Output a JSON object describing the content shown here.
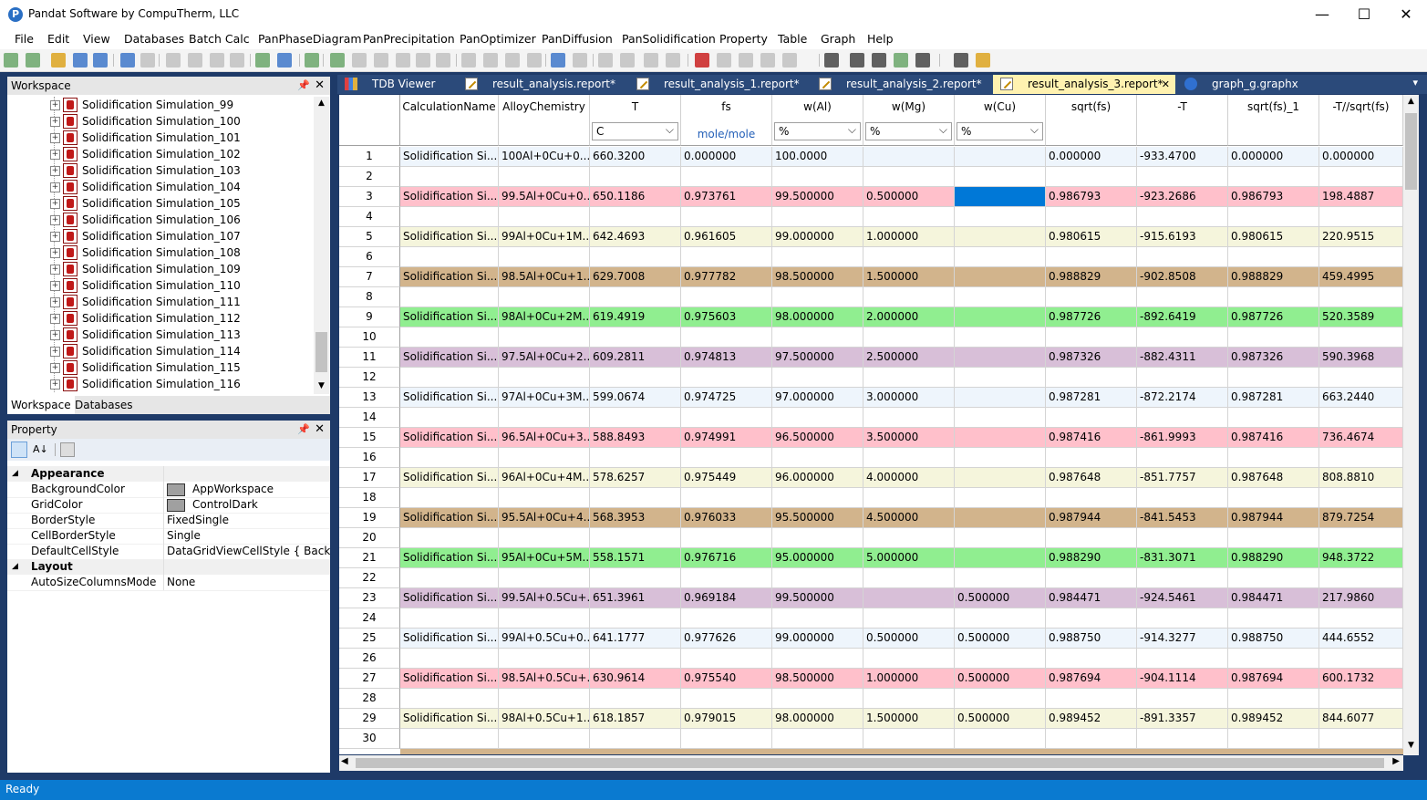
{
  "window": {
    "title": "Pandat Software by CompuTherm, LLC",
    "minimize": "—",
    "maximize": "☐",
    "close": "✕"
  },
  "menu": [
    "File",
    "Edit",
    "View",
    "Databases",
    "Batch Calc",
    "PanPhaseDiagram",
    "PanPrecipitation",
    "PanOptimizer",
    "PanDiffusion",
    "PanSolidification",
    "Property",
    "Table",
    "Graph",
    "Help"
  ],
  "workspace": {
    "title": "Workspace",
    "items": [
      "Solidification Simulation_99",
      "Solidification Simulation_100",
      "Solidification Simulation_101",
      "Solidification Simulation_102",
      "Solidification Simulation_103",
      "Solidification Simulation_104",
      "Solidification Simulation_105",
      "Solidification Simulation_106",
      "Solidification Simulation_107",
      "Solidification Simulation_108",
      "Solidification Simulation_109",
      "Solidification Simulation_110",
      "Solidification Simulation_111",
      "Solidification Simulation_112",
      "Solidification Simulation_113",
      "Solidification Simulation_114",
      "Solidification Simulation_115",
      "Solidification Simulation_116"
    ],
    "tabs": [
      "Workspace",
      "Databases"
    ]
  },
  "property": {
    "title": "Property",
    "categories": [
      {
        "name": "Appearance",
        "rows": [
          {
            "name": "BackgroundColor",
            "value": "AppWorkspace",
            "swatch": "#a0a0a0"
          },
          {
            "name": "GridColor",
            "value": "ControlDark",
            "swatch": "#a0a0a0"
          },
          {
            "name": "BorderStyle",
            "value": "FixedSingle"
          },
          {
            "name": "CellBorderStyle",
            "value": "Single"
          },
          {
            "name": "DefaultCellStyle",
            "value": "DataGridViewCellStyle { BackColor"
          }
        ]
      },
      {
        "name": "Layout",
        "rows": [
          {
            "name": "AutoSizeColumnsMode",
            "value": "None"
          }
        ]
      }
    ]
  },
  "doctabs": [
    {
      "label": "TDB Viewer",
      "icon": "tdb-icon"
    },
    {
      "label": "result_analysis.report*",
      "icon": "report-icon"
    },
    {
      "label": "result_analysis_1.report*",
      "icon": "report-icon"
    },
    {
      "label": "result_analysis_2.report*",
      "icon": "report-icon"
    },
    {
      "label": "result_analysis_3.report*",
      "icon": "report-icon",
      "active": true,
      "close": "✕"
    },
    {
      "label": "graph_g.graphx",
      "icon": "graph-icon"
    }
  ],
  "table": {
    "columns": [
      {
        "name": "CalculationName",
        "unit": ""
      },
      {
        "name": "AlloyChemistry",
        "unit": ""
      },
      {
        "name": "T",
        "unit": "C",
        "unit_kind": "select"
      },
      {
        "name": "fs",
        "unit": "mole/mole",
        "unit_kind": "text"
      },
      {
        "name": "w(Al)",
        "unit": "%",
        "unit_kind": "select"
      },
      {
        "name": "w(Mg)",
        "unit": "%",
        "unit_kind": "select"
      },
      {
        "name": "w(Cu)",
        "unit": "%",
        "unit_kind": "select"
      },
      {
        "name": "sqrt(fs)",
        "unit": ""
      },
      {
        "name": "-T",
        "unit": ""
      },
      {
        "name": "sqrt(fs)_1",
        "unit": ""
      },
      {
        "name": "-T//sqrt(fs)",
        "unit": ""
      }
    ],
    "rows": [
      {
        "n": "1",
        "color": "#eef5fc",
        "cells": [
          "Solidification Si...",
          "100Al+0Cu+0...",
          "660.3200",
          "0.000000",
          "100.0000",
          "",
          "",
          "0.000000",
          "-933.4700",
          "0.000000",
          "0.000000"
        ]
      },
      {
        "n": "2",
        "cells": null
      },
      {
        "n": "3",
        "color": "#ffc0cb",
        "cells": [
          "Solidification Si...",
          "99.5Al+0Cu+0...",
          "650.1186",
          "0.973761",
          "99.500000",
          "0.500000",
          "",
          "0.986793",
          "-923.2686",
          "0.986793",
          "198.4887"
        ]
      },
      {
        "n": "4",
        "cells": null
      },
      {
        "n": "5",
        "color": "#f5f5dc",
        "cells": [
          "Solidification Si...",
          "99Al+0Cu+1M...",
          "642.4693",
          "0.961605",
          "99.000000",
          "1.000000",
          "",
          "0.980615",
          "-915.6193",
          "0.980615",
          "220.9515"
        ]
      },
      {
        "n": "6",
        "cells": null
      },
      {
        "n": "7",
        "color": "#d2b48c",
        "cells": [
          "Solidification Si...",
          "98.5Al+0Cu+1...",
          "629.7008",
          "0.977782",
          "98.500000",
          "1.500000",
          "",
          "0.988829",
          "-902.8508",
          "0.988829",
          "459.4995"
        ]
      },
      {
        "n": "8",
        "cells": null
      },
      {
        "n": "9",
        "color": "#90ee90",
        "cells": [
          "Solidification Si...",
          "98Al+0Cu+2M...",
          "619.4919",
          "0.975603",
          "98.000000",
          "2.000000",
          "",
          "0.987726",
          "-892.6419",
          "0.987726",
          "520.3589"
        ]
      },
      {
        "n": "10",
        "cells": null
      },
      {
        "n": "11",
        "color": "#d8bfd8",
        "cells": [
          "Solidification Si...",
          "97.5Al+0Cu+2...",
          "609.2811",
          "0.974813",
          "97.500000",
          "2.500000",
          "",
          "0.987326",
          "-882.4311",
          "0.987326",
          "590.3968"
        ]
      },
      {
        "n": "12",
        "cells": null
      },
      {
        "n": "13",
        "color": "#eef5fc",
        "cells": [
          "Solidification Si...",
          "97Al+0Cu+3M...",
          "599.0674",
          "0.974725",
          "97.000000",
          "3.000000",
          "",
          "0.987281",
          "-872.2174",
          "0.987281",
          "663.2440"
        ]
      },
      {
        "n": "14",
        "cells": null
      },
      {
        "n": "15",
        "color": "#ffc0cb",
        "cells": [
          "Solidification Si...",
          "96.5Al+0Cu+3...",
          "588.8493",
          "0.974991",
          "96.500000",
          "3.500000",
          "",
          "0.987416",
          "-861.9993",
          "0.987416",
          "736.4674"
        ]
      },
      {
        "n": "16",
        "cells": null
      },
      {
        "n": "17",
        "color": "#f5f5dc",
        "cells": [
          "Solidification Si...",
          "96Al+0Cu+4M...",
          "578.6257",
          "0.975449",
          "96.000000",
          "4.000000",
          "",
          "0.987648",
          "-851.7757",
          "0.987648",
          "808.8810"
        ]
      },
      {
        "n": "18",
        "cells": null
      },
      {
        "n": "19",
        "color": "#d2b48c",
        "cells": [
          "Solidification Si...",
          "95.5Al+0Cu+4...",
          "568.3953",
          "0.976033",
          "95.500000",
          "4.500000",
          "",
          "0.987944",
          "-841.5453",
          "0.987944",
          "879.7254"
        ]
      },
      {
        "n": "20",
        "cells": null
      },
      {
        "n": "21",
        "color": "#90ee90",
        "cells": [
          "Solidification Si...",
          "95Al+0Cu+5M...",
          "558.1571",
          "0.976716",
          "95.000000",
          "5.000000",
          "",
          "0.988290",
          "-831.3071",
          "0.988290",
          "948.3722"
        ]
      },
      {
        "n": "22",
        "cells": null
      },
      {
        "n": "23",
        "color": "#d8bfd8",
        "cells": [
          "Solidification Si...",
          "99.5Al+0.5Cu+...",
          "651.3961",
          "0.969184",
          "99.500000",
          "",
          "0.500000",
          "0.984471",
          "-924.5461",
          "0.984471",
          "217.9860"
        ]
      },
      {
        "n": "24",
        "cells": null
      },
      {
        "n": "25",
        "color": "#eef5fc",
        "cells": [
          "Solidification Si...",
          "99Al+0.5Cu+0...",
          "641.1777",
          "0.977626",
          "99.000000",
          "0.500000",
          "0.500000",
          "0.988750",
          "-914.3277",
          "0.988750",
          "444.6552"
        ]
      },
      {
        "n": "26",
        "cells": null
      },
      {
        "n": "27",
        "color": "#ffc0cb",
        "cells": [
          "Solidification Si...",
          "98.5Al+0.5Cu+...",
          "630.9614",
          "0.975540",
          "98.500000",
          "1.000000",
          "0.500000",
          "0.987694",
          "-904.1114",
          "0.987694",
          "600.1732"
        ]
      },
      {
        "n": "28",
        "cells": null
      },
      {
        "n": "29",
        "color": "#f5f5dc",
        "cells": [
          "Solidification Si...",
          "98Al+0.5Cu+1...",
          "618.1857",
          "0.979015",
          "98.000000",
          "1.500000",
          "0.500000",
          "0.989452",
          "-891.3357",
          "0.989452",
          "844.6077"
        ]
      },
      {
        "n": "30",
        "cells": null
      }
    ],
    "selected": {
      "row": 2,
      "col": 6
    }
  },
  "status": "Ready"
}
